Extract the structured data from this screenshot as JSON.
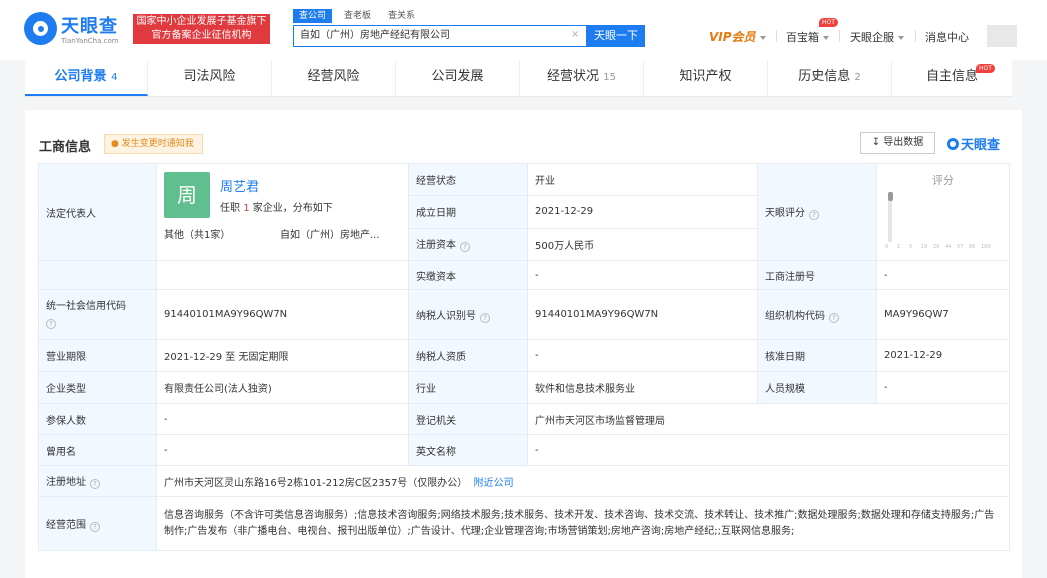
{
  "header": {
    "logo_cn": "天眼查",
    "logo_en": "TianYanCha.com",
    "badge_line1": "国家中小企业发展子基金旗下",
    "badge_line2": "官方备案企业征信机构",
    "search_tabs": [
      "查公司",
      "查老板",
      "查关系"
    ],
    "search_value": "自如（广州）房地产经纪有限公司",
    "search_clear": "×",
    "search_button": "天眼一下",
    "vip": "VIP会员",
    "nav_baibao": "百宝箱",
    "nav_qiye": "天眼企服",
    "nav_msg": "消息中心",
    "hot": "HOT"
  },
  "tabs": [
    {
      "label": "公司背景",
      "count": "4"
    },
    {
      "label": "司法风险",
      "count": ""
    },
    {
      "label": "经营风险",
      "count": ""
    },
    {
      "label": "公司发展",
      "count": ""
    },
    {
      "label": "经营状况",
      "count": "15"
    },
    {
      "label": "知识产权",
      "count": ""
    },
    {
      "label": "历史信息",
      "count": "2"
    },
    {
      "label": "自主信息",
      "count": ""
    }
  ],
  "section": {
    "title": "工商信息",
    "notify": "发生变更时通知我",
    "export": "导出数据",
    "brand": "天眼查"
  },
  "rep": {
    "label": "法定代表人",
    "avatar": "周",
    "name": "周艺君",
    "desc_pre": "任职",
    "desc_num": "1",
    "desc_post": "家企业，分布如下",
    "other": "其他（共1家）",
    "company": "自如（广州）房地产..."
  },
  "score": {
    "label": "天眼评分",
    "title": "评分",
    "ticks": [
      "0",
      "1",
      "5",
      "19",
      "20",
      "44",
      "57",
      "66",
      "100"
    ]
  },
  "rows": {
    "status_l": "经营状态",
    "status_v": "开业",
    "found_l": "成立日期",
    "found_v": "2021-12-29",
    "capital_l": "注册资本",
    "capital_v": "500万人民币",
    "paid_l": "实缴资本",
    "paid_v": "-",
    "regno_l": "工商注册号",
    "regno_v": "-",
    "credit_l": "统一社会信用代码",
    "credit_v": "91440101MA9Y96QW7N",
    "taxid_l": "纳税人识别号",
    "taxid_v": "91440101MA9Y96QW7N",
    "org_l": "组织机构代码",
    "org_v": "MA9Y96QW7",
    "term_l": "营业期限",
    "term_v": "2021-12-29  至 无固定期限",
    "taxq_l": "纳税人资质",
    "taxq_v": "-",
    "approve_l": "核准日期",
    "approve_v": "2021-12-29",
    "type_l": "企业类型",
    "type_v": "有限责任公司(法人独资)",
    "industry_l": "行业",
    "industry_v": "软件和信息技术服务业",
    "staff_l": "人员规模",
    "staff_v": "-",
    "insured_l": "参保人数",
    "insured_v": "-",
    "authority_l": "登记机关",
    "authority_v": "广州市天河区市场监督管理局",
    "former_l": "曾用名",
    "former_v": "-",
    "en_l": "英文名称",
    "en_v": "-",
    "addr_l": "注册地址",
    "addr_v": "广州市天河区灵山东路16号2栋101-212房C区2357号（仅限办公）",
    "addr_link": "附近公司",
    "scope_l": "经营范围",
    "scope_v": "信息咨询服务（不含许可类信息咨询服务）;信息技术咨询服务;网络技术服务;技术服务、技术开发、技术咨询、技术交流、技术转让、技术推广;数据处理服务;数据处理和存储支持服务;广告制作;广告发布（非广播电台、电视台、报刊出版单位）;广告设计、代理;企业管理咨询;市场营销策划;房地产咨询;房地产经纪;;互联网信息服务;"
  }
}
